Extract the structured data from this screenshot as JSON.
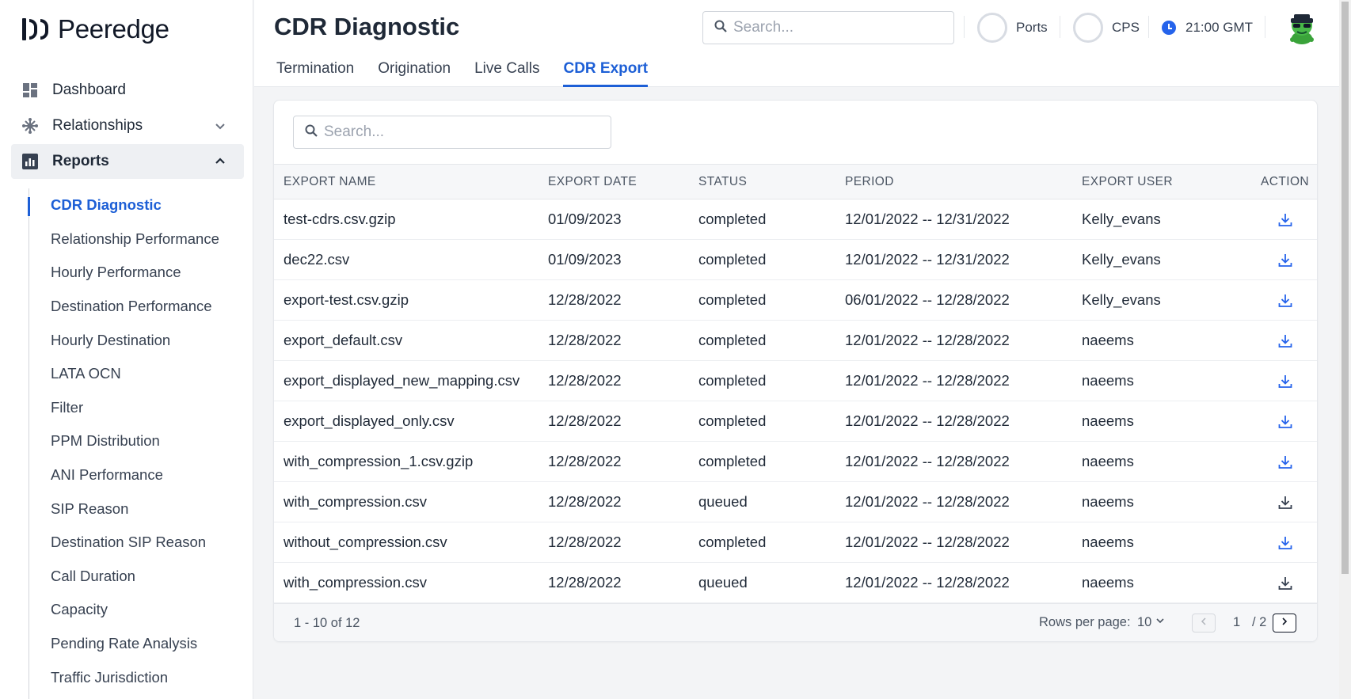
{
  "brand": {
    "name": "Peeredge"
  },
  "sidebar": {
    "items": [
      {
        "label": "Dashboard",
        "icon": "dashboard-icon"
      },
      {
        "label": "Relationships",
        "icon": "network-icon"
      },
      {
        "label": "Reports",
        "icon": "reports-icon"
      }
    ],
    "reports_sub": [
      "CDR Diagnostic",
      "Relationship Performance",
      "Hourly Performance",
      "Destination Performance",
      "Hourly Destination",
      "LATA OCN",
      "Filter",
      "PPM Distribution",
      "ANI Performance",
      "SIP Reason",
      "Destination SIP Reason",
      "Call Duration",
      "Capacity",
      "Pending Rate Analysis",
      "Traffic Jurisdiction"
    ]
  },
  "header": {
    "title": "CDR Diagnostic",
    "search_placeholder": "Search...",
    "ports_label": "Ports",
    "cps_label": "CPS",
    "time": "21:00 GMT",
    "tabs": [
      "Termination",
      "Origination",
      "Live Calls",
      "CDR Export"
    ]
  },
  "table": {
    "search_placeholder": "Search...",
    "columns": [
      "EXPORT NAME",
      "EXPORT DATE",
      "STATUS",
      "PERIOD",
      "EXPORT USER",
      "ACTION"
    ],
    "rows": [
      {
        "name": "test-cdrs.csv.gzip",
        "date": "01/09/2023",
        "status": "completed",
        "period": "12/01/2022 -- 12/31/2022",
        "user": "Kelly_evans"
      },
      {
        "name": "dec22.csv",
        "date": "01/09/2023",
        "status": "completed",
        "period": "12/01/2022 -- 12/31/2022",
        "user": "Kelly_evans"
      },
      {
        "name": "export-test.csv.gzip",
        "date": "12/28/2022",
        "status": "completed",
        "period": "06/01/2022 -- 12/28/2022",
        "user": "Kelly_evans"
      },
      {
        "name": "export_default.csv",
        "date": "12/28/2022",
        "status": "completed",
        "period": "12/01/2022 -- 12/28/2022",
        "user": "naeems"
      },
      {
        "name": "export_displayed_new_mapping.csv",
        "date": "12/28/2022",
        "status": "completed",
        "period": "12/01/2022 -- 12/28/2022",
        "user": "naeems"
      },
      {
        "name": "export_displayed_only.csv",
        "date": "12/28/2022",
        "status": "completed",
        "period": "12/01/2022 -- 12/28/2022",
        "user": "naeems"
      },
      {
        "name": "with_compression_1.csv.gzip",
        "date": "12/28/2022",
        "status": "completed",
        "period": "12/01/2022 -- 12/28/2022",
        "user": "naeems"
      },
      {
        "name": "with_compression.csv",
        "date": "12/28/2022",
        "status": "queued",
        "period": "12/01/2022 -- 12/28/2022",
        "user": "naeems"
      },
      {
        "name": "without_compression.csv",
        "date": "12/28/2022",
        "status": "completed",
        "period": "12/01/2022 -- 12/28/2022",
        "user": "naeems"
      },
      {
        "name": "with_compression.csv",
        "date": "12/28/2022",
        "status": "queued",
        "period": "12/01/2022 -- 12/28/2022",
        "user": "naeems"
      }
    ],
    "footer": {
      "range": "1 - 10 of 12",
      "rows_per_page_label": "Rows per page:",
      "rows_per_page_value": "10",
      "current_page": "1",
      "total_pages": "/ 2"
    }
  },
  "colors": {
    "accent": "#1d5fd6",
    "download_completed": "#2563eb",
    "download_queued": "#374151"
  }
}
